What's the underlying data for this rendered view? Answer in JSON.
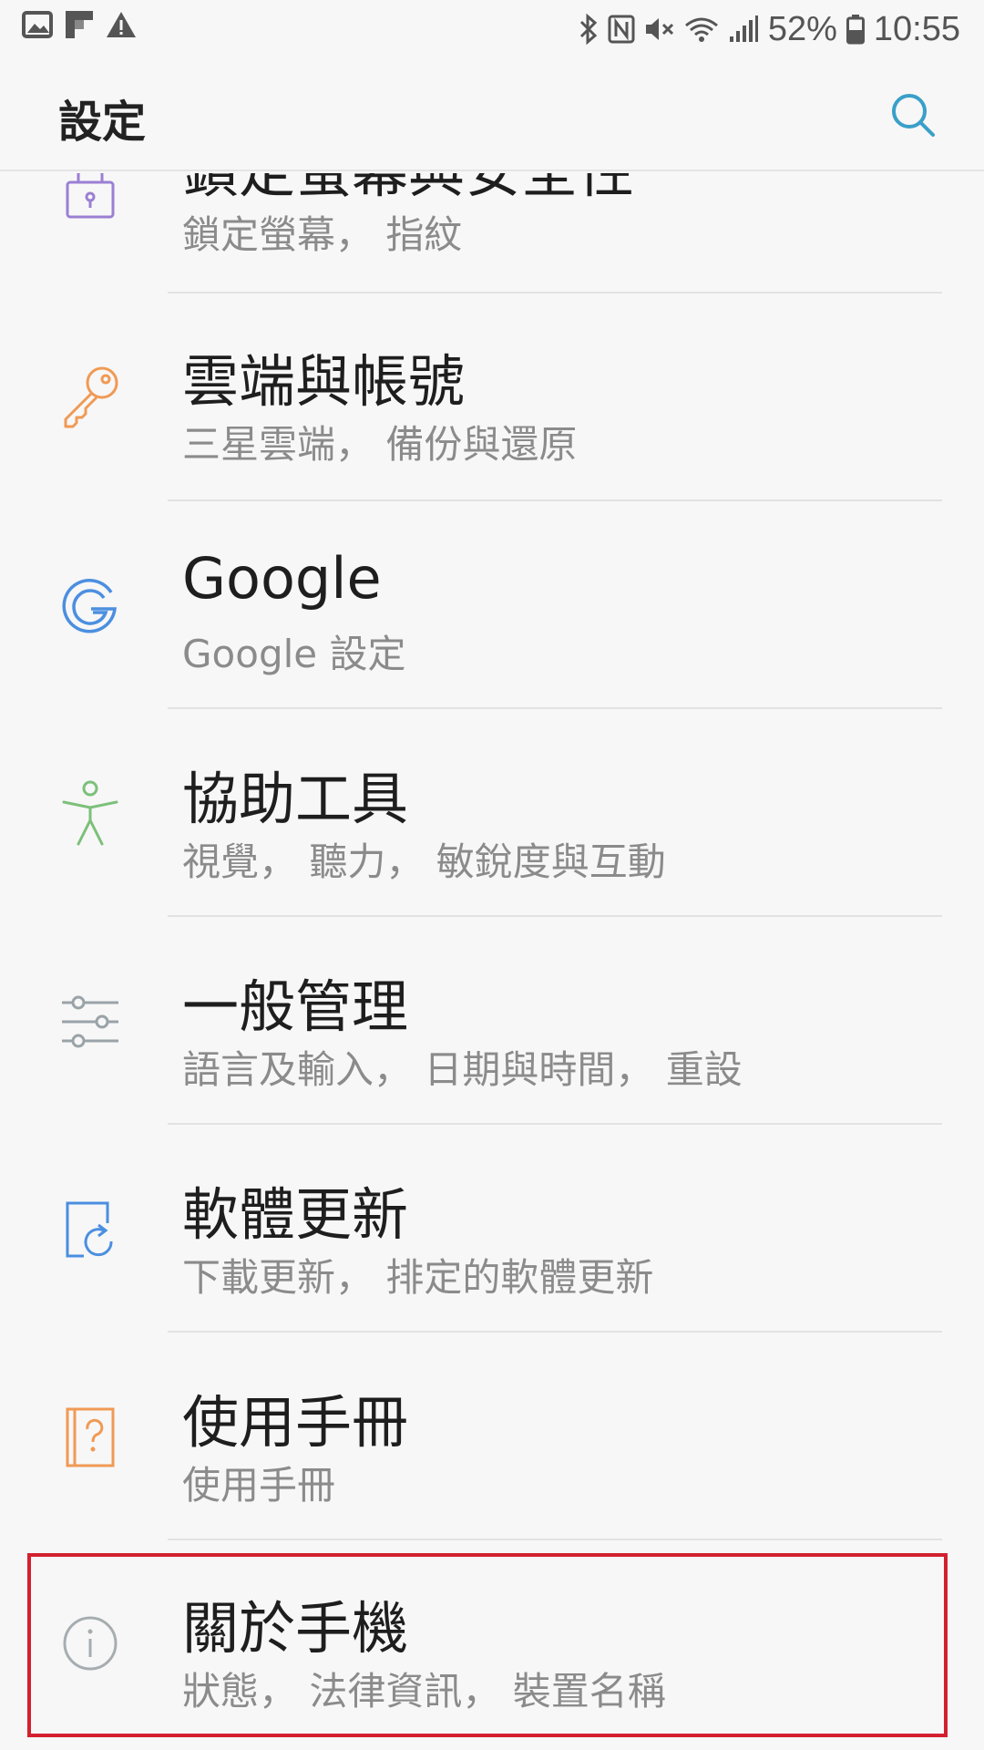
{
  "status_bar": {
    "battery_percent": "52%",
    "time": "10:55",
    "left_icons": [
      "image-icon",
      "flipboard-icon",
      "warning-icon"
    ],
    "right_icons": [
      "bluetooth-icon",
      "nfc-icon",
      "mute-icon",
      "wifi-icon",
      "signal-icon",
      "battery-icon"
    ]
  },
  "header": {
    "title": "設定",
    "search_icon": "search-icon"
  },
  "settings": [
    {
      "title": "鎖定螢幕與安全性",
      "subtitle": "鎖定螢幕， 指紋",
      "icon": "lock-icon",
      "color": "#9b7fd4"
    },
    {
      "title": "雲端與帳號",
      "subtitle": "三星雲端， 備份與還原",
      "icon": "key-icon",
      "color": "#f09a55"
    },
    {
      "title": "Google",
      "subtitle": "Google 設定",
      "icon": "google-icon",
      "color": "#4b8fe0"
    },
    {
      "title": "協助工具",
      "subtitle": "視覺， 聽力， 敏銳度與互動",
      "icon": "accessibility-icon",
      "color": "#7cc07a"
    },
    {
      "title": "一般管理",
      "subtitle": "語言及輸入， 日期與時間， 重設",
      "icon": "sliders-icon",
      "color": "#9aa3a8"
    },
    {
      "title": "軟體更新",
      "subtitle": "下載更新， 排定的軟體更新",
      "icon": "update-icon",
      "color": "#4b8fe0"
    },
    {
      "title": "使用手冊",
      "subtitle": "使用手冊",
      "icon": "manual-icon",
      "color": "#f09a55"
    },
    {
      "title": "關於手機",
      "subtitle": "狀態， 法律資訊， 裝置名稱",
      "icon": "info-icon",
      "color": "#a6adb0"
    }
  ],
  "colors": {
    "background": "#f7f7f7",
    "highlight": "#d3202f",
    "search": "#3a9fc9"
  }
}
